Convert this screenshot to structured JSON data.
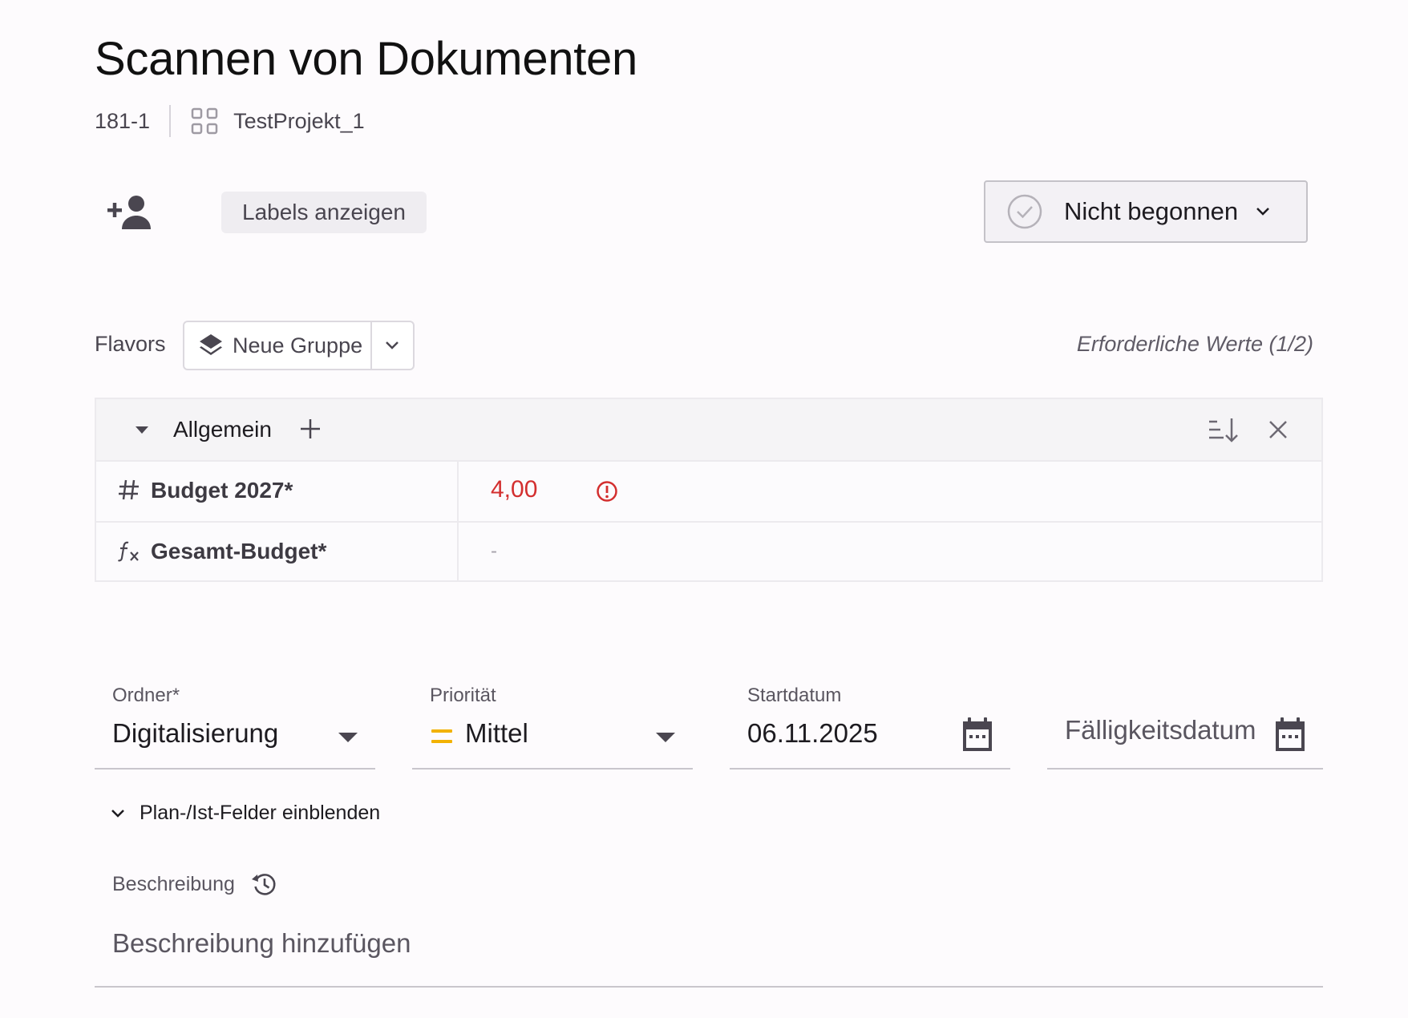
{
  "task": {
    "title": "Scannen von Dokumenten",
    "id": "181-1",
    "project": "TestProjekt_1"
  },
  "toolbar": {
    "labels_button": "Labels anzeigen",
    "status": "Nicht begonnen"
  },
  "flavors": {
    "label": "Flavors",
    "group": "Neue Gruppe",
    "required_values": "Erforderliche Werte (1/2)"
  },
  "panel": {
    "name": "Allgemein",
    "rows": [
      {
        "icon": "hash-icon",
        "name": "Budget 2027*",
        "value": "4,00",
        "error": true
      },
      {
        "icon": "function-icon",
        "name": "Gesamt-Budget*",
        "value": "-",
        "error": false
      }
    ]
  },
  "fields": {
    "folder": {
      "label": "Ordner*",
      "value": "Digitalisierung"
    },
    "priority": {
      "label": "Priorität",
      "value": "Mittel"
    },
    "start": {
      "label": "Startdatum",
      "value": "06.11.2025"
    },
    "due": {
      "placeholder": "Fälligkeitsdatum"
    }
  },
  "plan_toggle": "Plan-/Ist-Felder einblenden",
  "description": {
    "label": "Beschreibung",
    "placeholder": "Beschreibung hinzufügen"
  },
  "colors": {
    "error": "#d32f2f",
    "priority_medium": "#f2b203",
    "icon": "#5f5b66"
  }
}
